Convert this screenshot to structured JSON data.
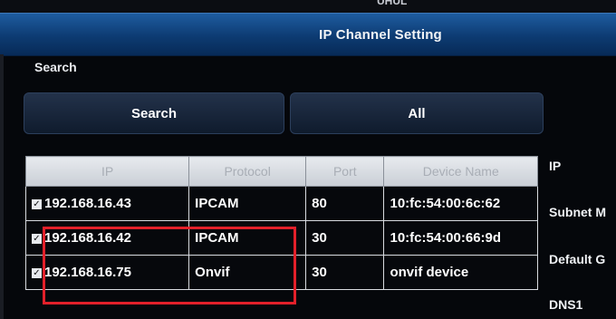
{
  "window": {
    "title": "IP Channel Setting",
    "top_fragment": "UHUL"
  },
  "search": {
    "section_label": "Search",
    "search_button": "Search",
    "all_button": "All"
  },
  "table": {
    "headers": [
      "IP",
      "Protocol",
      "Port",
      "Device Name"
    ],
    "rows": [
      {
        "ip": "192.168.16.43",
        "protocol": "IPCAM",
        "port": "80",
        "device_name": "10:fc:54:00:6c:62",
        "checked": true
      },
      {
        "ip": "192.168.16.42",
        "protocol": "IPCAM",
        "port": "30",
        "device_name": "10:fc:54:00:66:9d",
        "checked": true
      },
      {
        "ip": "192.168.16.75",
        "protocol": "Onvif",
        "port": "30",
        "device_name": "onvif device",
        "checked": true
      }
    ]
  },
  "right_panel": {
    "ip_label": "IP",
    "subnet_label": "Subnet M",
    "gateway_label": "Default G",
    "dns_label": "DNS1"
  },
  "colors": {
    "title_bar": "#0d3b72",
    "annotation": "#e3202a"
  }
}
